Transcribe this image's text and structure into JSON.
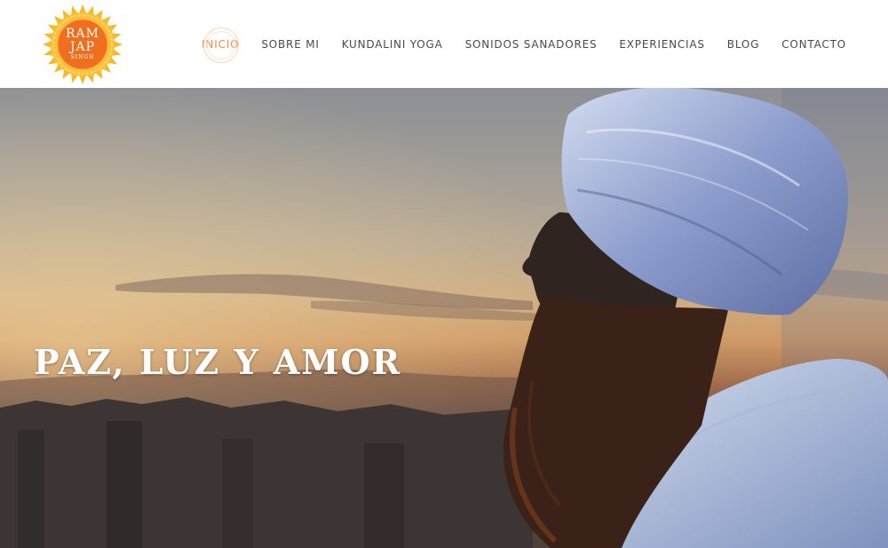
{
  "logo": {
    "line1": "RAM",
    "line2": "JAP",
    "line3": "SINGH",
    "icon": "sun-mandala-logo"
  },
  "nav": {
    "items": [
      {
        "label": "INICIO",
        "active": true
      },
      {
        "label": "SOBRE MI",
        "active": false
      },
      {
        "label": "KUNDALINI YOGA",
        "active": false
      },
      {
        "label": "SONIDOS SANADORES",
        "active": false
      },
      {
        "label": "EXPERIENCIAS",
        "active": false
      },
      {
        "label": "BLOG",
        "active": false
      },
      {
        "label": "CONTACTO",
        "active": false
      }
    ]
  },
  "hero": {
    "title": "PAZ, LUZ Y AMOR",
    "image": "man-in-turban-sunset-photo"
  },
  "colors": {
    "accent": "#f08a3c",
    "nav_text": "#4a4a4a",
    "logo_outer": "#f7b928",
    "logo_inner": "#ef6f1f"
  }
}
